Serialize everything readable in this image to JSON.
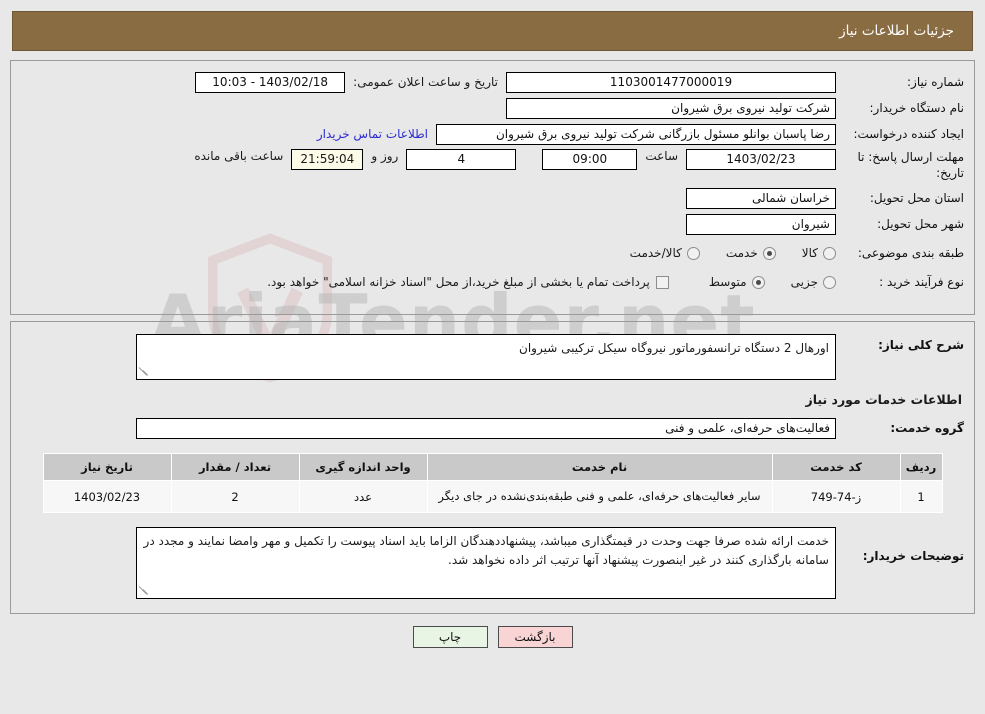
{
  "header": {
    "title": "جزئیات اطلاعات نیاز"
  },
  "info": {
    "need_number_label": "شماره نیاز:",
    "need_number_value": "1103001477000019",
    "announce_datetime_label": "تاریخ و ساعت اعلان عمومی:",
    "announce_datetime_value": "1403/02/18 - 10:03",
    "buyer_org_label": "نام دستگاه خریدار:",
    "buyer_org_value": "شرکت تولید نیروی برق شیروان",
    "creator_label": "ایجاد کننده درخواست:",
    "creator_value": "رضا پاسبان بوانلو مسئول بازرگانی شرکت تولید نیروی برق شیروان",
    "contact_link": "اطلاعات تماس خریدار",
    "deadline_label": "مهلت ارسال پاسخ: تا تاریخ:",
    "deadline_date": "1403/02/23",
    "time_label": "ساعت",
    "deadline_time": "09:00",
    "days_value": "4",
    "days_label": "روز و",
    "countdown_value": "21:59:04",
    "countdown_label": "ساعت باقی مانده",
    "province_label": "استان محل تحویل:",
    "province_value": "خراسان شمالی",
    "city_label": "شهر محل تحویل:",
    "city_value": "شیروان",
    "category_label": "طبقه بندی موضوعی:",
    "category_options": [
      {
        "label": "کالا",
        "selected": false
      },
      {
        "label": "خدمت",
        "selected": true
      },
      {
        "label": "کالا/خدمت",
        "selected": false
      }
    ],
    "process_label": "نوع فرآیند خرید :",
    "process_options": [
      {
        "label": "جزیی",
        "selected": false
      },
      {
        "label": "متوسط",
        "selected": true
      }
    ],
    "treasury_checked": false,
    "treasury_note": "پرداخت تمام یا بخشی از مبلغ خرید،از محل \"اسناد خزانه اسلامی\" خواهد بود."
  },
  "detail": {
    "summary_label": "شرح کلی نیاز:",
    "summary_value": "اورهال 2 دستگاه ترانسفورماتور نیروگاه سیکل ترکیبی شیروان",
    "services_section_title": "اطلاعات خدمات مورد نیاز",
    "service_group_label": "گروه خدمت:",
    "service_group_value": "فعالیت‌های حرفه‌ای، علمی و فنی",
    "table": {
      "columns": [
        "ردیف",
        "کد خدمت",
        "نام خدمت",
        "واحد اندازه گیری",
        "تعداد / مقدار",
        "تاریخ نیاز"
      ],
      "rows": [
        {
          "row_no": "1",
          "service_code": "ز-74-749",
          "service_name": "سایر فعالیت‌های حرفه‌ای، علمی و فنی طبقه‌بندی‌نشده در جای دیگر",
          "unit": "عدد",
          "quantity": "2",
          "need_date": "1403/02/23"
        }
      ]
    },
    "buyer_notes_label": "توضیحات خریدار:",
    "buyer_notes_value": "خدمت ارائه شده صرفا جهت وحدت در قیمتگذاری میباشد، پیشنهاددهندگان الزاما باید اسناد پیوست را تکمیل و مهر وامضا نمایند و مجدد در سامانه بارگذاری کنند در غیر اینصورت پیشنهاد آنها ترتیب اثر داده نخواهد شد."
  },
  "footer": {
    "back_label": "بازگشت",
    "print_label": "چاپ"
  },
  "watermark": {
    "text": "AriaTender.net"
  },
  "colors": {
    "header_bar": "#8a6c43",
    "link": "#2b2bd4",
    "back_button": "#f8d4d4",
    "print_button": "#e9f5e4",
    "countdown_bg": "#fbfbe8",
    "table_header": "#c9c9c9",
    "page_bg": "#e8e8e8"
  }
}
